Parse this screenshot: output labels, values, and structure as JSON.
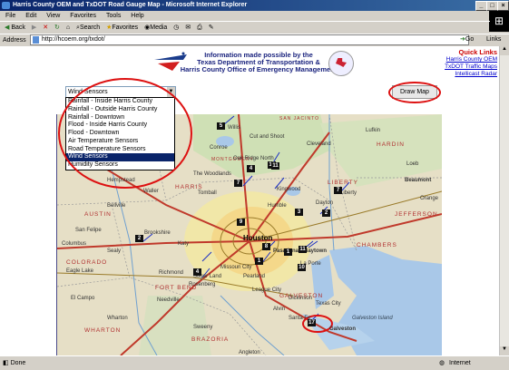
{
  "window": {
    "title": "Harris County OEM and TxDOT Road Gauge Map - Microsoft Internet Explorer"
  },
  "menu": [
    "File",
    "Edit",
    "View",
    "Favorites",
    "Tools",
    "Help"
  ],
  "toolbar": {
    "back": "Back",
    "search": "Search",
    "favorites": "Favorites",
    "media": "Media"
  },
  "address": {
    "label": "Address",
    "url": "http://hcoem.org/txdot/",
    "go": "Go",
    "links": "Links"
  },
  "page": {
    "credit_line1": "Information made possible by the",
    "credit_line2": "Texas Department of Transportation &",
    "credit_line3": "Harris County Office of Emergency Management",
    "quick_links_title": "Quick Links",
    "quick_links": [
      "Harris County OEM",
      "TxDOT Traffic Maps",
      "Intellicast Radar"
    ],
    "draw_button": "Draw Map",
    "select_value": "Wind Sensors",
    "select_options": [
      "Rainfall - Inside Harris County",
      "Rainfall - Outside Harris County",
      "Rainfall - Downtown",
      "Flood - Inside Harris County",
      "Flood - Downtown",
      "Air Temperature Sensors",
      "Road Temperature Sensors",
      "Wind Sensors",
      "Humidity Sensors"
    ],
    "selected_index": 7
  },
  "map": {
    "counties": [
      "HARDIN",
      "HARRIS",
      "LIBERTY",
      "AUSTIN",
      "JEFFERSON",
      "CHAMBERS",
      "COLORADO",
      "FORT BEND",
      "GALVESTON",
      "WHARTON",
      "BRAZORIA",
      "MONTGOMERY",
      "SAN JACINTO"
    ],
    "places": [
      "Conroe",
      "Willis",
      "Cut and Shoot",
      "Oak Ridge North",
      "The Woodlands",
      "Hempstead",
      "Waller",
      "Tomball",
      "Humble",
      "Kingwood",
      "Dayton",
      "Liberty",
      "Beaumont",
      "Bellville",
      "Sealy",
      "Katy",
      "Brookshire",
      "San Felipe",
      "Houston",
      "Pasadena",
      "Baytown",
      "La Porte",
      "Pearland",
      "League City",
      "Missouri City",
      "Sugar Land",
      "Rosenberg",
      "Richmond",
      "Alvin",
      "Angleton",
      "Texas City",
      "Galveston",
      "Eagle Lake",
      "Columbus",
      "Needville",
      "Sweeny",
      "El Campo",
      "Wharton",
      "Galveston Island",
      "Cleveland",
      "Lufkin",
      "Loeb",
      "Orange",
      "Santa Fe",
      "Dickinson"
    ],
    "sensor_ids": [
      "5",
      "11",
      "7",
      "7",
      "4",
      "2",
      "3",
      "8",
      "1",
      "11",
      "10",
      "4",
      "17",
      "9",
      "1",
      "11",
      "2"
    ]
  },
  "status": {
    "left": "Done",
    "zone": "Internet"
  }
}
